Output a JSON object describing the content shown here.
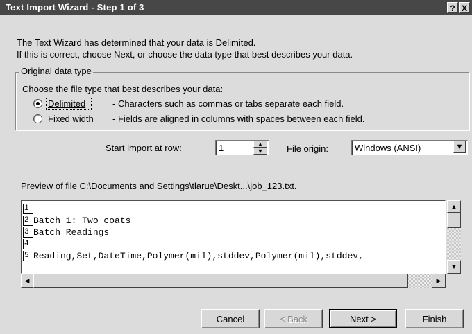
{
  "window": {
    "title": "Text Import Wizard - Step 1 of 3",
    "help_button": "?",
    "close_button": "X"
  },
  "intro": {
    "line1": "The Text Wizard has determined that your data is Delimited.",
    "line2": "If this is correct, choose Next, or choose the data type that best describes your data."
  },
  "original_data_type": {
    "legend": "Original data type",
    "prompt": "Choose the file type that best describes your data:",
    "options": [
      {
        "label": "Delimited",
        "description": "- Characters such as commas or tabs separate each field.",
        "selected": true
      },
      {
        "label": "Fixed width",
        "description": "- Fields are aligned in columns with spaces between each field.",
        "selected": false
      }
    ]
  },
  "start_import": {
    "label": "Start import at row:",
    "value": "1"
  },
  "file_origin": {
    "label": "File origin:",
    "value": "Windows (ANSI)"
  },
  "preview": {
    "label": "Preview of file C:\\Documents and Settings\\tlarue\\Deskt...\\job_123.txt.",
    "rows": [
      {
        "num": "1",
        "text": ""
      },
      {
        "num": "2",
        "text": "Batch 1: Two coats"
      },
      {
        "num": "3",
        "text": "Batch Readings"
      },
      {
        "num": "4",
        "text": ""
      },
      {
        "num": "5",
        "text": "Reading,Set,DateTime,Polymer(mil),stddev,Polymer(mil),stddev,"
      }
    ]
  },
  "buttons": {
    "cancel": "Cancel",
    "back": "< Back",
    "next": "Next >",
    "finish": "Finish"
  }
}
